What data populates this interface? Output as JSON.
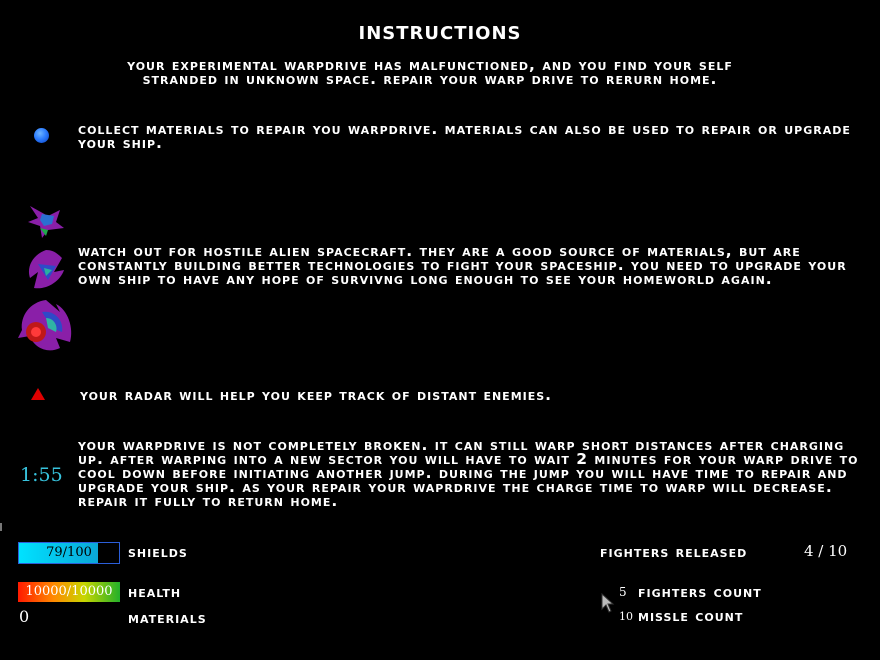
{
  "title": "Instructions",
  "intro": "Your experimental warpdrive has malfunctioned, and you find your self stranded in unknown space. Repair your warp drive to rerurn home.",
  "sections": {
    "materials": {
      "icon": "blue-orb-icon",
      "text": "Collect materials to repair you warpdrive. Materials can also be used to repair or upgrade your ship."
    },
    "aliens": {
      "icons": [
        "alien-fighter-icon",
        "alien-cruiser-icon",
        "alien-mothership-icon"
      ],
      "text": "Watch out for hostile alien spacecraft. They are a good source of materials, but are constantly building better technologies to fight your spaceship. You need to upgrade your own ship to have any hope of survivng long enough to see your homeworld again."
    },
    "radar": {
      "icon": "red-triangle-icon",
      "text": "Your radar will help you keep track of distant enemies."
    },
    "warp": {
      "timer": "1:55",
      "text": "Your warpdrive is not completely broken. It can still warp short distances after charging up. After warping into a new sector you will have to wait 2 minutes for your warp drive to cool down before initiating another jump. During the jump you will have time to repair and upgrade your ship. As your repair your waprdrive the charge time to warp will decrease. Repair it fully to return home."
    }
  },
  "hud": {
    "shields": {
      "label": "Shields",
      "value": "79/100",
      "fraction": 0.79,
      "color": "#00e2ff"
    },
    "health": {
      "label": "Health",
      "value": "10000/10000",
      "fraction": 1.0
    },
    "materials": {
      "label": "Materials",
      "value": "0"
    },
    "fighters_released": {
      "label": "Fighters Released",
      "value": "4 / 10"
    },
    "fighters_count": {
      "label": "Fighters Count",
      "value": "5"
    },
    "missle_count": {
      "label": "Missle Count",
      "value": "10"
    }
  },
  "colors": {
    "timer": "#37c3dd",
    "radar": "#e00000",
    "orb": "#2d7dff"
  }
}
